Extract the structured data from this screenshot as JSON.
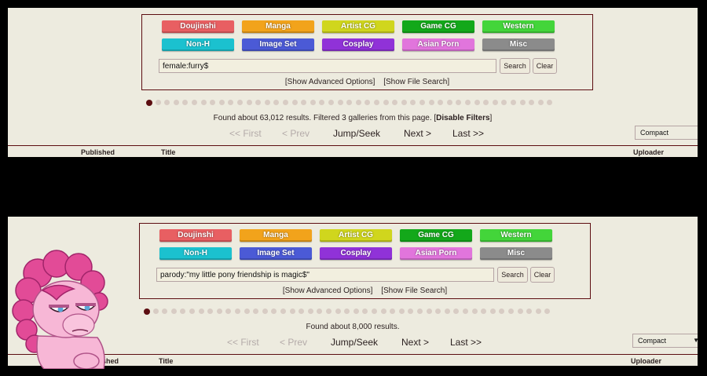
{
  "categories": [
    "Doujinshi",
    "Manga",
    "Artist CG",
    "Game CG",
    "Western",
    "Non-H",
    "Image Set",
    "Cosplay",
    "Asian Porn",
    "Misc"
  ],
  "category_colors": [
    "#e85f62",
    "#f2a31b",
    "#d0d61d",
    "#13a81a",
    "#43d53a",
    "#1bc1cf",
    "#4b5ad6",
    "#9032d8",
    "#e175dc",
    "#8b8b8b"
  ],
  "links": {
    "advanced": "[Show Advanced Options]",
    "file": "[Show File Search]"
  },
  "buttons": {
    "search": "Search",
    "clear": "Clear"
  },
  "top": {
    "query": "female:furry$",
    "found_prefix": "Found about 63,012 results. Filtered 3 galleries from this page. [",
    "filter_link": "Disable Filters",
    "found_suffix": "]"
  },
  "bottom": {
    "query": "parody:\"my little pony friendship is magic$\"",
    "found_text": "Found about 8,000 results."
  },
  "nav": {
    "first": "<< First",
    "prev": "< Prev",
    "jump": "Jump/Seek",
    "next": "Next >",
    "last": "Last >>"
  },
  "view_mode": "Compact",
  "columns": {
    "published": "Published",
    "published_partial": "ublished",
    "title": "Title",
    "uploader": "Uploader"
  },
  "pager_dots_count": 45
}
